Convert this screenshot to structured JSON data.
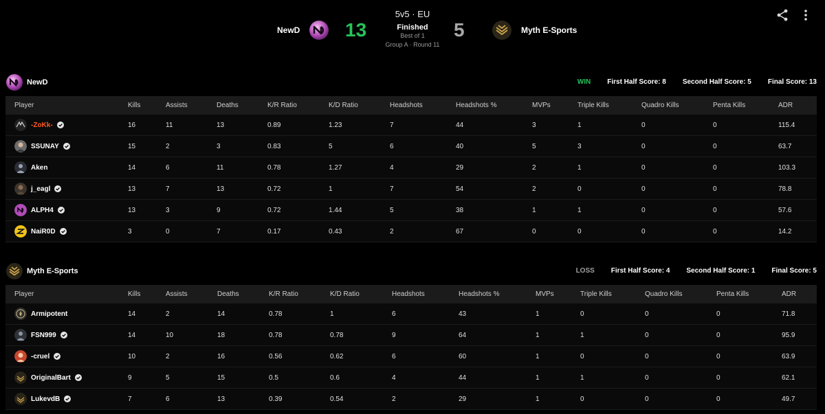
{
  "match": {
    "mode": "5v5 · EU",
    "status": "Finished",
    "best_of": "Best of 1",
    "group": "Group A · Round 11",
    "team_left": "NewD",
    "score_left": "13",
    "team_right": "Myth E-Sports",
    "score_right": "5"
  },
  "colors": {
    "win": "#27c25a",
    "loss": "#a0a0a0",
    "highlight_player": "#ff5a1f"
  },
  "icons": {
    "share": "share-icon",
    "more": "more-vertical-icon",
    "verified": "verified-check-icon"
  },
  "columns": [
    "Player",
    "Kills",
    "Assists",
    "Deaths",
    "K/R Ratio",
    "K/D Ratio",
    "Headshots",
    "Headshots %",
    "MVPs",
    "Triple Kills",
    "Quadro Kills",
    "Penta Kills",
    "ADR"
  ],
  "teams": [
    {
      "name": "NewD",
      "result": "WIN",
      "first_half": "First Half Score: 8",
      "second_half": "Second Half Score: 5",
      "final": "Final Score: 13",
      "players": [
        {
          "name": "-ZoKk-",
          "stats": [
            "16",
            "11",
            "13",
            "0.89",
            "1.23",
            "7",
            "44",
            "3",
            "1",
            "0",
            "0",
            "115.4"
          ]
        },
        {
          "name": "SSUNAY",
          "stats": [
            "15",
            "2",
            "3",
            "0.83",
            "5",
            "6",
            "40",
            "5",
            "3",
            "0",
            "0",
            "63.7"
          ]
        },
        {
          "name": "Aken",
          "stats": [
            "14",
            "6",
            "11",
            "0.78",
            "1.27",
            "4",
            "29",
            "2",
            "1",
            "0",
            "0",
            "103.3"
          ]
        },
        {
          "name": "j_eagl",
          "stats": [
            "13",
            "7",
            "13",
            "0.72",
            "1",
            "7",
            "54",
            "2",
            "0",
            "0",
            "0",
            "78.8"
          ]
        },
        {
          "name": "ALPH4",
          "stats": [
            "13",
            "3",
            "9",
            "0.72",
            "1.44",
            "5",
            "38",
            "1",
            "1",
            "0",
            "0",
            "57.6"
          ]
        },
        {
          "name": "NaiR0D",
          "stats": [
            "3",
            "0",
            "7",
            "0.17",
            "0.43",
            "2",
            "67",
            "0",
            "0",
            "0",
            "0",
            "14.2"
          ]
        }
      ]
    },
    {
      "name": "Myth E-Sports",
      "result": "LOSS",
      "first_half": "First Half Score: 4",
      "second_half": "Second Half Score: 1",
      "final": "Final Score: 5",
      "players": [
        {
          "name": "Armipotent",
          "stats": [
            "14",
            "2",
            "14",
            "0.78",
            "1",
            "6",
            "43",
            "1",
            "0",
            "0",
            "0",
            "71.8"
          ]
        },
        {
          "name": "FSN999",
          "stats": [
            "14",
            "10",
            "18",
            "0.78",
            "0.78",
            "9",
            "64",
            "1",
            "1",
            "0",
            "0",
            "95.9"
          ]
        },
        {
          "name": "-cruel",
          "stats": [
            "10",
            "2",
            "16",
            "0.56",
            "0.62",
            "6",
            "60",
            "1",
            "0",
            "0",
            "0",
            "63.9"
          ]
        },
        {
          "name": "OriginalBart",
          "stats": [
            "9",
            "5",
            "15",
            "0.5",
            "0.6",
            "4",
            "44",
            "1",
            "1",
            "0",
            "0",
            "62.1"
          ]
        },
        {
          "name": "LukevdB",
          "stats": [
            "7",
            "6",
            "13",
            "0.39",
            "0.54",
            "2",
            "29",
            "1",
            "0",
            "0",
            "0",
            "49.7"
          ]
        }
      ]
    }
  ]
}
